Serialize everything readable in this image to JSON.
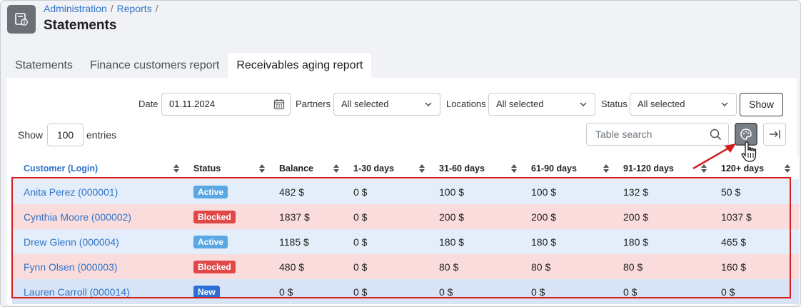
{
  "breadcrumb": {
    "items": [
      "Administration",
      "Reports"
    ],
    "separator": "/"
  },
  "page_title": "Statements",
  "tabs": [
    {
      "label": "Statements",
      "active": false
    },
    {
      "label": "Finance customers report",
      "active": false
    },
    {
      "label": "Receivables aging report",
      "active": true
    }
  ],
  "filters": {
    "date_label": "Date",
    "date_value": "01.11.2024",
    "partners_label": "Partners",
    "partners_value": "All selected",
    "locations_label": "Locations",
    "locations_value": "All selected",
    "status_label": "Status",
    "status_value": "All selected",
    "show_button": "Show"
  },
  "entries": {
    "prefix": "Show",
    "value": "100",
    "suffix": "entries"
  },
  "search": {
    "placeholder": "Table search"
  },
  "icons": {
    "app": "document-info-icon",
    "calendar": "calendar-icon",
    "chevron": "chevron-down-icon",
    "search": "search-icon",
    "settings": "palette-icon",
    "export": "arrow-right-to-bar-icon",
    "sort": "sort-icon",
    "cursor": "hand-pointer-icon"
  },
  "table": {
    "columns": [
      "Customer (Login)",
      "Status",
      "Balance",
      "1-30 days",
      "31-60 days",
      "61-90 days",
      "91-120 days",
      "120+ days"
    ],
    "rows": [
      {
        "customer": "Anita Perez (000001)",
        "status": "Active",
        "balance": "482 $",
        "d1_30": "0 $",
        "d31_60": "100 $",
        "d61_90": "100 $",
        "d91_120": "132 $",
        "d120": "50 $"
      },
      {
        "customer": "Cynthia Moore (000002)",
        "status": "Blocked",
        "balance": "1837 $",
        "d1_30": "0 $",
        "d31_60": "200 $",
        "d61_90": "200 $",
        "d91_120": "200 $",
        "d120": "1037 $"
      },
      {
        "customer": "Drew Glenn (000004)",
        "status": "Active",
        "balance": "1185 $",
        "d1_30": "0 $",
        "d31_60": "180 $",
        "d61_90": "180 $",
        "d91_120": "180 $",
        "d120": "465 $"
      },
      {
        "customer": "Fynn Olsen (000003)",
        "status": "Blocked",
        "balance": "480 $",
        "d1_30": "0 $",
        "d31_60": "80 $",
        "d61_90": "80 $",
        "d91_120": "80 $",
        "d120": "160 $"
      },
      {
        "customer": "Lauren Carroll (000014)",
        "status": "New",
        "balance": "0 $",
        "d1_30": "0 $",
        "d31_60": "0 $",
        "d61_90": "0 $",
        "d91_120": "0 $",
        "d120": "0 $"
      }
    ]
  },
  "colors": {
    "link": "#2f73c9",
    "active_badge": "#5aa8e3",
    "blocked_badge": "#e04848",
    "new_badge": "#2c6fd6",
    "highlight": "#d21e1e"
  }
}
